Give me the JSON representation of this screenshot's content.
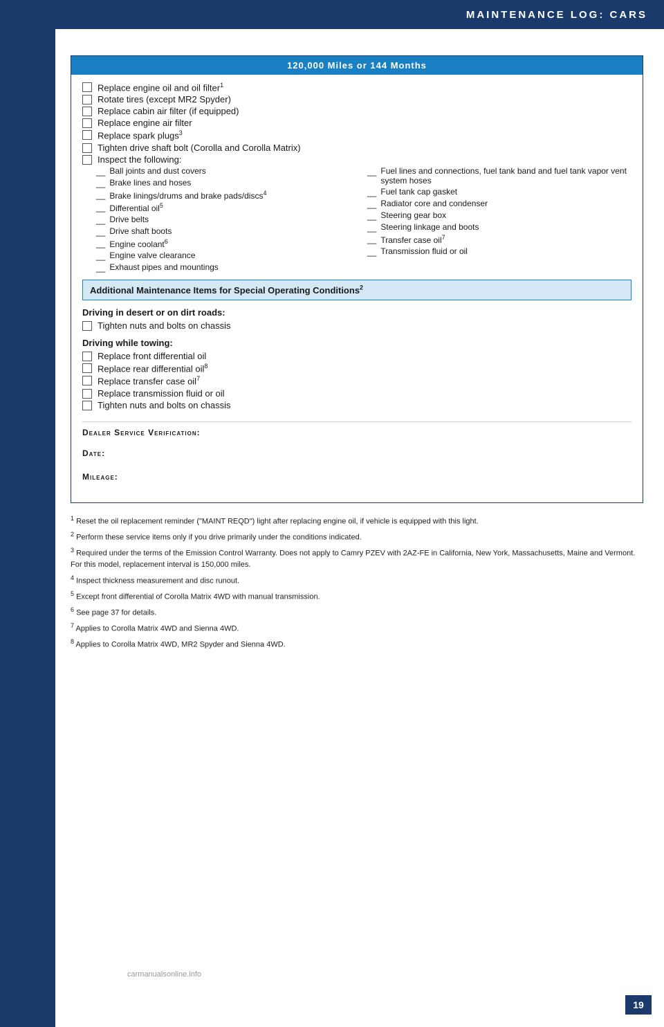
{
  "header": {
    "title": "Maintenance Log: Cars",
    "page_number": "19"
  },
  "main_section": {
    "title": "120,000 Miles or 144 Months",
    "checkbox_items": [
      "Replace engine oil and oil filter¹",
      "Rotate tires (except MR2 Spyder)",
      "Replace cabin air filter (if equipped)",
      "Replace engine air filter",
      "Replace spark plugs³",
      "Tighten drive shaft bolt (Corolla and Corolla Matrix)",
      "Inspect the following:"
    ],
    "inspect_left": [
      "Ball joints and dust covers",
      "Brake lines and hoses",
      "Brake linings/drums and brake pads/discs⁴",
      "Differential oil⁵",
      "Drive belts",
      "Drive shaft boots",
      "Engine coolant⁶",
      "Engine valve clearance",
      "Exhaust pipes and mountings"
    ],
    "inspect_right": [
      "Fuel lines and connections, fuel tank band and fuel tank vapor vent system hoses",
      "Fuel tank cap gasket",
      "Radiator core and condenser",
      "Steering gear box",
      "Steering linkage and boots",
      "Transfer case oil⁷",
      "Transmission fluid or oil"
    ],
    "additional_title": "Additional Maintenance Items for Special Operating Conditions²",
    "driving_desert_header": "Driving in desert or on dirt roads:",
    "driving_desert_items": [
      "Tighten nuts and bolts on chassis"
    ],
    "driving_towing_header": "Driving while towing:",
    "driving_towing_items": [
      "Replace front differential oil",
      "Replace rear differential oil⁸",
      "Replace transfer case oil⁷",
      "Replace transmission fluid or oil",
      "Tighten nuts and bolts on chassis"
    ],
    "dealer_label": "Dealer Service Verification:",
    "date_label": "Date:",
    "mileage_label": "Mileage:"
  },
  "footnotes": [
    {
      "num": "1",
      "text": "Reset the oil replacement reminder (“MAINT REQD”) light after replacing engine oil, if vehicle is equipped with this light."
    },
    {
      "num": "2",
      "text": "Perform these service items only if you drive primarily under the conditions indicated."
    },
    {
      "num": "3",
      "text": "Required under the terms of the Emission Control Warranty. Does not apply to Camry PZEV with 2AZ-FE in California, New York, Massachusetts, Maine and Vermont. For this model, replacement interval is 150,000 miles."
    },
    {
      "num": "4",
      "text": "Inspect thickness measurement and disc runout."
    },
    {
      "num": "5",
      "text": "Except front differential of Corolla Matrix 4WD with manual transmission."
    },
    {
      "num": "6",
      "text": "See page 37 for details."
    },
    {
      "num": "7",
      "text": "Applies to Corolla Matrix 4WD and Sienna 4WD."
    },
    {
      "num": "8",
      "text": "Applies to Corolla Matrix 4WD, MR2 Spyder and Sienna 4WD."
    }
  ]
}
